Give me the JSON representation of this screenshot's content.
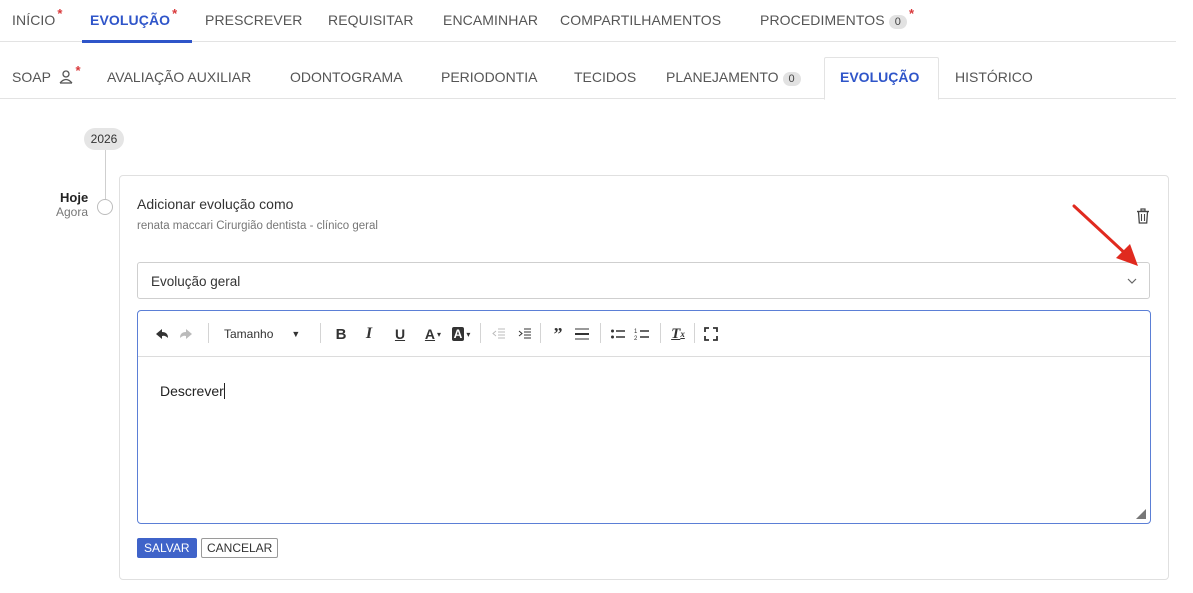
{
  "top_tabs": {
    "inicio": "INÍCIO",
    "evolucao": "EVOLUÇÃO",
    "prescrever": "PRESCREVER",
    "requisitar": "REQUISITAR",
    "encaminhar": "ENCAMINHAR",
    "compartilhamentos": "COMPARTILHAMENTOS",
    "procedimentos": "PROCEDIMENTOS",
    "procedimentos_count": "0",
    "required_mark": "*"
  },
  "sub_tabs": {
    "soap": "SOAP",
    "avaliacao_auxiliar": "AVALIAÇÃO AUXILIAR",
    "odontograma": "ODONTOGRAMA",
    "periodontia": "PERIODONTIA",
    "tecidos": "TECIDOS",
    "planejamento": "PLANEJAMENTO",
    "planejamento_count": "0",
    "evolucao": "EVOLUÇÃO",
    "historico": "HISTÓRICO"
  },
  "timeline": {
    "year": "2026",
    "day_label": "Hoje",
    "time_label": "Agora"
  },
  "card": {
    "title": "Adicionar evolução como",
    "subtitle": "renata maccari Cirurgião dentista - clínico geral",
    "select_value": "Evolução geral",
    "toolbar": {
      "size_label": "Tamanho"
    },
    "editor_text": "Descrever",
    "save_label": "SALVAR",
    "cancel_label": "CANCELAR"
  },
  "colors": {
    "accent": "#2f55c9",
    "required": "#d9383a",
    "annotation_arrow": "#e02a1f"
  },
  "icons": [
    "undo-icon",
    "redo-icon",
    "bold-icon",
    "italic-icon",
    "underline-icon",
    "font-color-icon",
    "background-color-icon",
    "outdent-icon",
    "indent-icon",
    "blockquote-icon",
    "horizontal-rule-icon",
    "bullet-list-icon",
    "numbered-list-icon",
    "clear-format-icon",
    "fullscreen-icon",
    "trash-icon",
    "chevron-down-icon",
    "user-icon"
  ]
}
